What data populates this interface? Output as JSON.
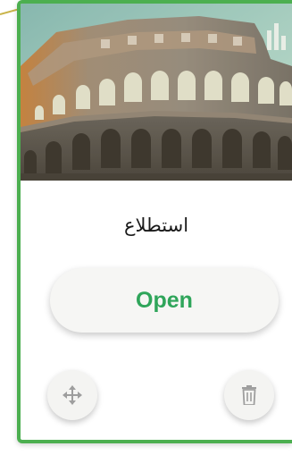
{
  "card": {
    "title": "استطلاع",
    "image_icon": "colosseum-photo",
    "open_label": "Open",
    "move_icon": "move-arrows-icon",
    "delete_icon": "trash-icon"
  },
  "colors": {
    "card_border": "#4caf50",
    "open_text": "#2fa55a",
    "button_bg": "#f6f6f4",
    "icon_gray": "#9e9e9e",
    "corner_line": "#c9b44a"
  }
}
